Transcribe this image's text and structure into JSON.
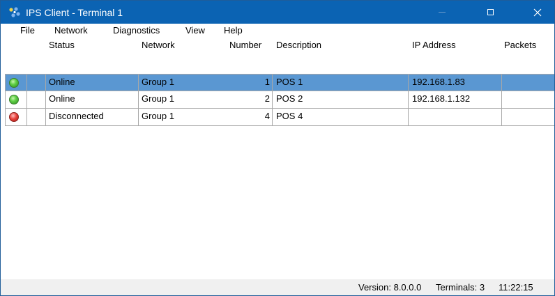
{
  "window": {
    "title": "IPS Client - Terminal 1",
    "titlebar_color": "#0b63b3",
    "icons": [
      "app-icon",
      "minimize-icon",
      "maximize-icon",
      "close-icon"
    ]
  },
  "menu": {
    "items": [
      "File",
      "Network",
      "Diagnostics",
      "View",
      "Help"
    ]
  },
  "table": {
    "columns": [
      "Status",
      "Network",
      "Number",
      "Description",
      "IP Address",
      "Packets"
    ],
    "rows": [
      {
        "led": "green",
        "status": "Online",
        "network": "Group 1",
        "number": "1",
        "description": "POS 1",
        "ip": "192.168.1.83",
        "packets": "",
        "selected": true
      },
      {
        "led": "green",
        "status": "Online",
        "network": "Group 1",
        "number": "2",
        "description": "POS 2",
        "ip": "192.168.1.132",
        "packets": "",
        "selected": false
      },
      {
        "led": "red",
        "status": "Disconnected",
        "network": "Group 1",
        "number": "4",
        "description": "POS 4",
        "ip": "",
        "packets": "",
        "selected": false
      }
    ],
    "selected_row_color": "#5a97d2"
  },
  "statusbar": {
    "version": "Version: 8.0.0.0",
    "terminals": "Terminals: 3",
    "time": "11:22:15"
  }
}
